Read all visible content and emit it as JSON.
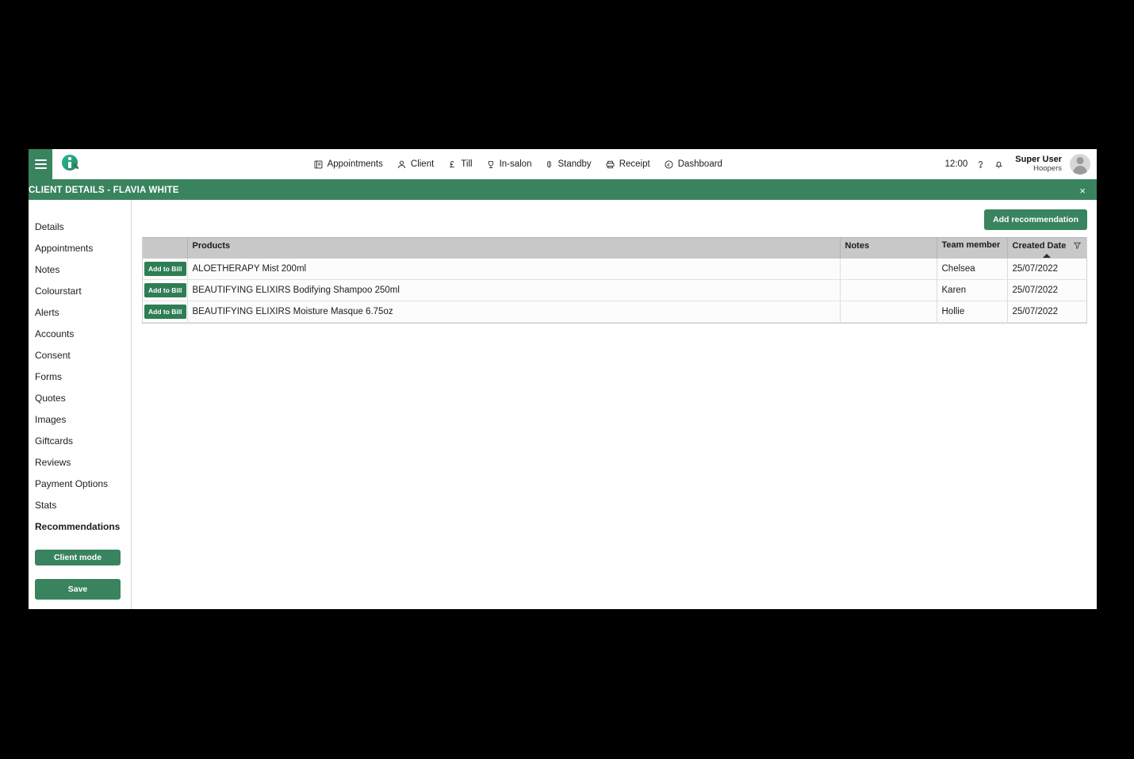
{
  "header": {
    "menu_icon": "hamburger-icon",
    "logo": "iq-logo",
    "nav": [
      {
        "label": "Appointments",
        "icon": "book-icon"
      },
      {
        "label": "Client",
        "icon": "person-icon"
      },
      {
        "label": "Till",
        "icon": "pound-icon"
      },
      {
        "label": "In-salon",
        "icon": "chair-icon"
      },
      {
        "label": "Standby",
        "icon": "pin-icon"
      },
      {
        "label": "Receipt",
        "icon": "printer-icon"
      },
      {
        "label": "Dashboard",
        "icon": "gauge-icon"
      }
    ],
    "clock": "12:00",
    "help_icon": "question-lightbulb-icon",
    "bell_icon": "notification-bell-icon",
    "user_name": "Super User",
    "user_org": "Hoopers",
    "avatar": "user-avatar"
  },
  "title_bar": {
    "title": "CLIENT DETAILS - FLAVIA WHITE",
    "close_label": "×"
  },
  "sidebar": {
    "items": [
      {
        "label": "Details",
        "active": false
      },
      {
        "label": "Appointments",
        "active": false
      },
      {
        "label": "Notes",
        "active": false
      },
      {
        "label": "Colourstart",
        "active": false
      },
      {
        "label": "Alerts",
        "active": false
      },
      {
        "label": "Accounts",
        "active": false
      },
      {
        "label": "Consent",
        "active": false
      },
      {
        "label": "Forms",
        "active": false
      },
      {
        "label": "Quotes",
        "active": false
      },
      {
        "label": "Images",
        "active": false
      },
      {
        "label": "Giftcards",
        "active": false
      },
      {
        "label": "Reviews",
        "active": false
      },
      {
        "label": "Payment Options",
        "active": false
      },
      {
        "label": "Stats",
        "active": false
      },
      {
        "label": "Recommendations",
        "active": true
      }
    ],
    "client_mode_label": "Client mode",
    "save_label": "Save"
  },
  "main": {
    "add_recommendation_label": "Add recommendation",
    "table": {
      "columns": [
        {
          "key": "action",
          "label": ""
        },
        {
          "key": "products",
          "label": "Products"
        },
        {
          "key": "notes",
          "label": "Notes"
        },
        {
          "key": "team_member",
          "label": "Team member"
        },
        {
          "key": "created_date",
          "label": "Created Date"
        }
      ],
      "sort": {
        "column": "Created Date",
        "direction": "ascending"
      },
      "filter_icon": "filter-funnel-icon",
      "row_action_label": "Add to Bill",
      "rows": [
        {
          "product": "ALOETHERAPY Mist 200ml",
          "notes": "",
          "team_member": "Chelsea",
          "created_date": "25/07/2022"
        },
        {
          "product": "BEAUTIFYING ELIXIRS Bodifying Shampoo 250ml",
          "notes": "",
          "team_member": "Karen",
          "created_date": "25/07/2022"
        },
        {
          "product": "BEAUTIFYING ELIXIRS Moisture Masque 6.75oz",
          "notes": "",
          "team_member": "Hollie",
          "created_date": "25/07/2022"
        }
      ]
    }
  },
  "colors": {
    "brand_green": "#39845f",
    "button_green": "#2f7d55",
    "header_grey": "#c8c8c8",
    "page_background": "#000000"
  }
}
